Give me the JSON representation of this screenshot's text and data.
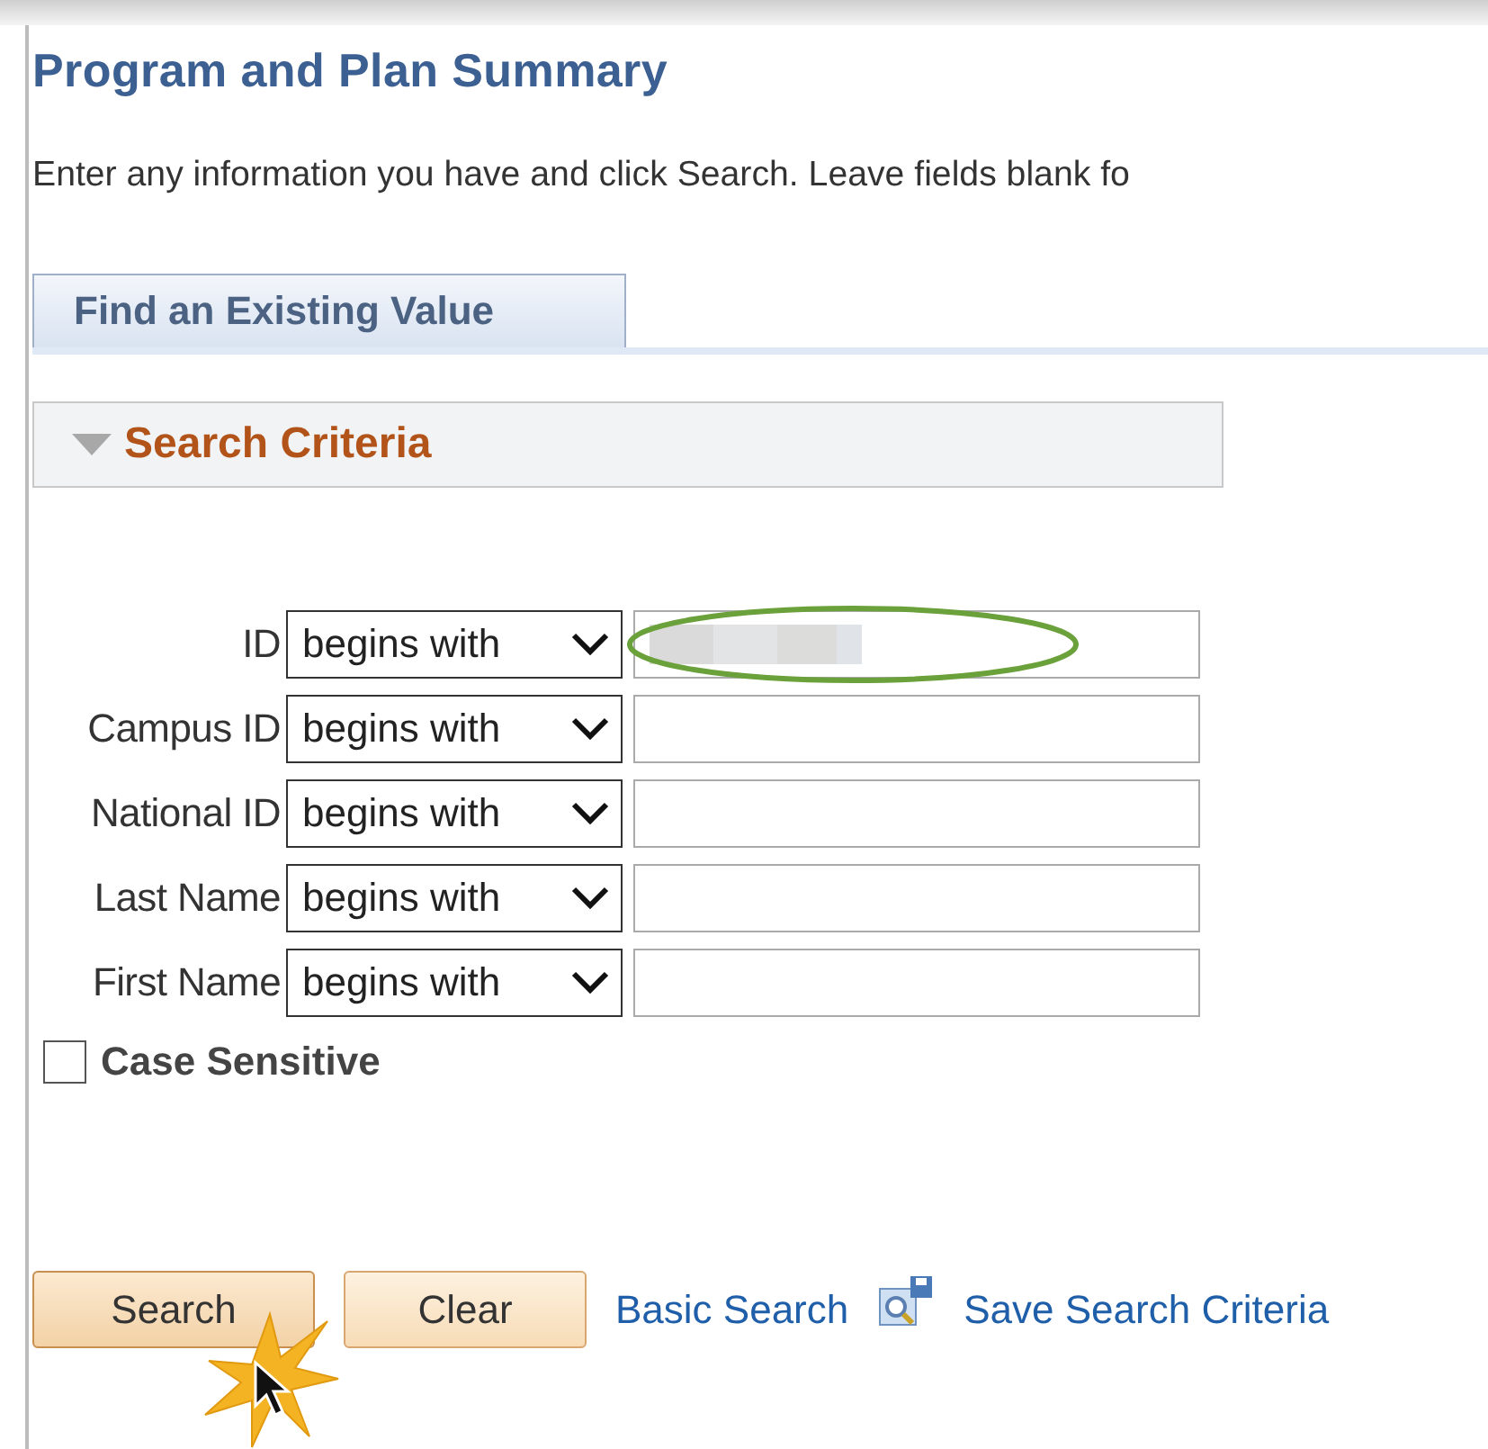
{
  "page": {
    "title": "Program and Plan Summary",
    "instructions": "Enter any information you have and click Search. Leave fields blank fo"
  },
  "tabs": [
    {
      "label": "Find an Existing Value",
      "selected": true
    }
  ],
  "section": {
    "title": "Search Criteria",
    "expanded": true
  },
  "criteria": [
    {
      "label": "ID",
      "operator": "begins with",
      "highlighted": true,
      "redacted": true
    },
    {
      "label": "Campus ID",
      "operator": "begins with",
      "highlighted": false,
      "redacted": false
    },
    {
      "label": "National ID",
      "operator": "begins with",
      "highlighted": false,
      "redacted": false
    },
    {
      "label": "Last Name",
      "operator": "begins with",
      "highlighted": false,
      "redacted": false
    },
    {
      "label": "First Name",
      "operator": "begins with",
      "highlighted": false,
      "redacted": false
    }
  ],
  "case_sensitive": {
    "label": "Case Sensitive",
    "checked": false
  },
  "buttons": [
    {
      "label": "Search",
      "clicked": true
    },
    {
      "label": "Clear",
      "clicked": false
    }
  ],
  "links": [
    {
      "label": "Basic Search",
      "icon": false
    },
    {
      "label": "Save Search Criteria",
      "icon": true
    }
  ]
}
